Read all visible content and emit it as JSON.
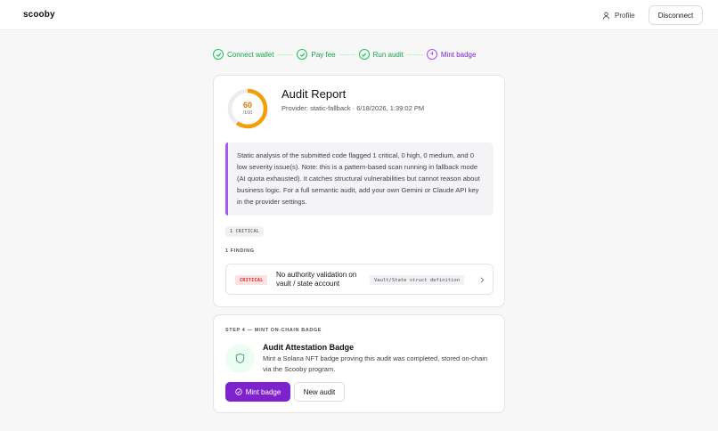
{
  "header": {
    "brand": "scooby",
    "profile_label": "Profile",
    "disconnect_label": "Disconnect"
  },
  "stepper": {
    "steps": [
      {
        "label": "Connect wallet",
        "state": "done"
      },
      {
        "label": "Pay fee",
        "state": "done"
      },
      {
        "label": "Run audit",
        "state": "done"
      },
      {
        "label": "Mint badge",
        "state": "active",
        "number": "4"
      }
    ]
  },
  "report": {
    "score": "60",
    "score_max": "/100",
    "score_fraction": 0.6,
    "title": "Audit Report",
    "meta": "Provider: static-fallback · 6/18/2026, 1:39:02 PM",
    "summary": "Static analysis of the submitted code flagged 1 critical, 0 high, 0 medium, and 0 low severity issue(s). Note: this is a pattern-based scan running in fallback mode (AI quota exhausted). It catches structural vulnerabilities but cannot reason about business logic. For a full semantic audit, add your own Gemini or Claude API key in the provider settings.",
    "severity_badge": "1 CRITICAL",
    "findings_label": "1 FINDING",
    "findings": [
      {
        "severity": "CRITICAL",
        "title": "No authority validation on vault / state account",
        "location": "Vault/State struct definition"
      }
    ]
  },
  "mint": {
    "step_label": "STEP 4 — MINT ON-CHAIN BADGE",
    "badge_title": "Audit Attestation Badge",
    "badge_desc": "Mint a Solana NFT badge proving this audit was completed, stored on-chain via the Scooby program.",
    "mint_label": "Mint badge",
    "new_audit_label": "New audit"
  },
  "colors": {
    "accent": "#7e22ce",
    "success": "#22c55e",
    "score": "#f59e0b",
    "critical": "#dc2626"
  }
}
